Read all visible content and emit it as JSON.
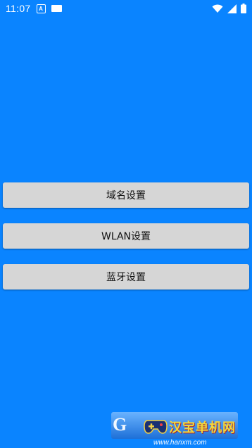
{
  "status_bar": {
    "time": "11:07",
    "notif_letter": "A",
    "icons": [
      "wifi-icon",
      "signal-icon",
      "battery-icon"
    ]
  },
  "buttons": [
    {
      "label": "域名设置"
    },
    {
      "label": "WLAN设置"
    },
    {
      "label": "蓝牙设置"
    }
  ],
  "watermark": {
    "logo_text": "汉宝单机网",
    "url": "www.hanxm.com"
  },
  "colors": {
    "background": "#0a84ff",
    "button": "#d6d6d6"
  }
}
